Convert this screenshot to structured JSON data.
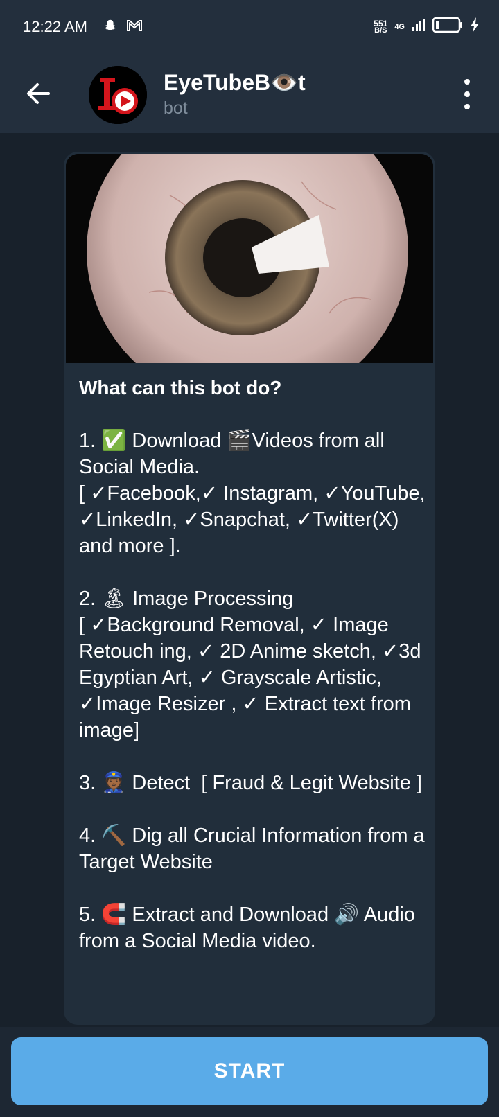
{
  "status": {
    "time": "12:22 AM",
    "net_speed_value": "551",
    "net_speed_unit": "B/S",
    "network": "4G"
  },
  "header": {
    "title": "EyeTubeB👁️t",
    "subtitle": "bot"
  },
  "message": {
    "heading": "What can this bot do?",
    "items": [
      "1. ✅ Download 🎬Videos from all Social Media.\n[ ✓Facebook,✓ Instagram, ✓YouTube, ✓LinkedIn, ✓Snapchat, ✓Twitter(X) and more ].",
      "2. 🏝 Image Processing\n[ ✓Background Removal, ✓ Image Retouch ing, ✓ 2D Anime sketch, ✓3d Egyptian Art, ✓ Grayscale Artistic, ✓Image Resizer , ✓ Extract text from image]",
      "3. 👮🏾 Detect  [ Fraud & Legit Website ]",
      "4. ⛏️ Dig all Crucial Information from a Target Website",
      "5. 🧲 Extract and Download 🔊 Audio from a Social Media video."
    ]
  },
  "start_button": {
    "label": "START"
  },
  "colors": {
    "header_bg": "#232f3d",
    "bubble_bg": "#212e3b",
    "start_btn": "#5aabe8",
    "subtitle": "#7f8d9b"
  },
  "icons": [
    "back-arrow-icon",
    "more-vert-icon",
    "snapchat-icon",
    "gmail-icon",
    "battery-icon",
    "charging-icon",
    "signal-icon"
  ]
}
